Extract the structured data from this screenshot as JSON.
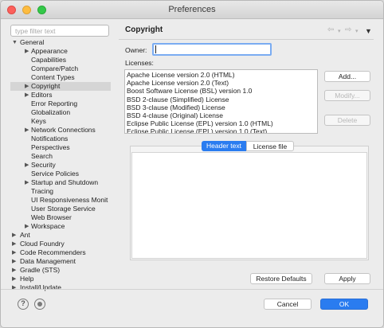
{
  "window": {
    "title": "Preferences"
  },
  "filter": {
    "placeholder": "type filter text"
  },
  "tree": [
    {
      "label": "General",
      "arrow": "▼",
      "level": 0
    },
    {
      "label": "Appearance",
      "arrow": "▶",
      "level": 1
    },
    {
      "label": "Capabilities",
      "arrow": "",
      "level": 2
    },
    {
      "label": "Compare/Patch",
      "arrow": "",
      "level": 2
    },
    {
      "label": "Content Types",
      "arrow": "",
      "level": 2
    },
    {
      "label": "Copyright",
      "arrow": "▶",
      "level": 1,
      "selected": true
    },
    {
      "label": "Editors",
      "arrow": "▶",
      "level": 1
    },
    {
      "label": "Error Reporting",
      "arrow": "",
      "level": 2
    },
    {
      "label": "Globalization",
      "arrow": "",
      "level": 2
    },
    {
      "label": "Keys",
      "arrow": "",
      "level": 2
    },
    {
      "label": "Network Connections",
      "arrow": "▶",
      "level": 1
    },
    {
      "label": "Notifications",
      "arrow": "",
      "level": 2
    },
    {
      "label": "Perspectives",
      "arrow": "",
      "level": 2
    },
    {
      "label": "Search",
      "arrow": "",
      "level": 2
    },
    {
      "label": "Security",
      "arrow": "▶",
      "level": 1
    },
    {
      "label": "Service Policies",
      "arrow": "",
      "level": 2
    },
    {
      "label": "Startup and Shutdown",
      "arrow": "▶",
      "level": 1
    },
    {
      "label": "Tracing",
      "arrow": "",
      "level": 2
    },
    {
      "label": "UI Responsiveness Monit",
      "arrow": "",
      "level": 2
    },
    {
      "label": "User Storage Service",
      "arrow": "",
      "level": 2
    },
    {
      "label": "Web Browser",
      "arrow": "",
      "level": 2
    },
    {
      "label": "Workspace",
      "arrow": "▶",
      "level": 1
    },
    {
      "label": "Ant",
      "arrow": "▶",
      "level": 0
    },
    {
      "label": "Cloud Foundry",
      "arrow": "▶",
      "level": 0
    },
    {
      "label": "Code Recommenders",
      "arrow": "▶",
      "level": 0
    },
    {
      "label": "Data Management",
      "arrow": "▶",
      "level": 0
    },
    {
      "label": "Gradle (STS)",
      "arrow": "▶",
      "level": 0
    },
    {
      "label": "Help",
      "arrow": "▶",
      "level": 0
    },
    {
      "label": "Install/Update",
      "arrow": "▶",
      "level": 0
    }
  ],
  "panel": {
    "title": "Copyright",
    "nav_back": "⇦",
    "nav_forward": "⇨",
    "owner_label": "Owner:",
    "owner_value": "",
    "licenses_label": "Licenses:",
    "licenses": [
      "Apache License version 2.0 (HTML)",
      "Apache License version 2.0 (Text)",
      "Boost Software License (BSL) version 1.0",
      "BSD 2-clause (Simplified) License",
      "BSD 3-clause (Modified) License",
      "BSD 4-clause (Original) License",
      "Eclipse Public License (EPL) version 1.0 (HTML)",
      "Eclipse Public License (EPL) version 1.0 (Text)"
    ],
    "add_label": "Add...",
    "modify_label": "Modify...",
    "delete_label": "Delete",
    "tab_header": "Header text",
    "tab_license": "License file",
    "restore_label": "Restore Defaults",
    "apply_label": "Apply"
  },
  "footer": {
    "help_glyph": "?",
    "cancel_label": "Cancel",
    "ok_label": "OK"
  }
}
